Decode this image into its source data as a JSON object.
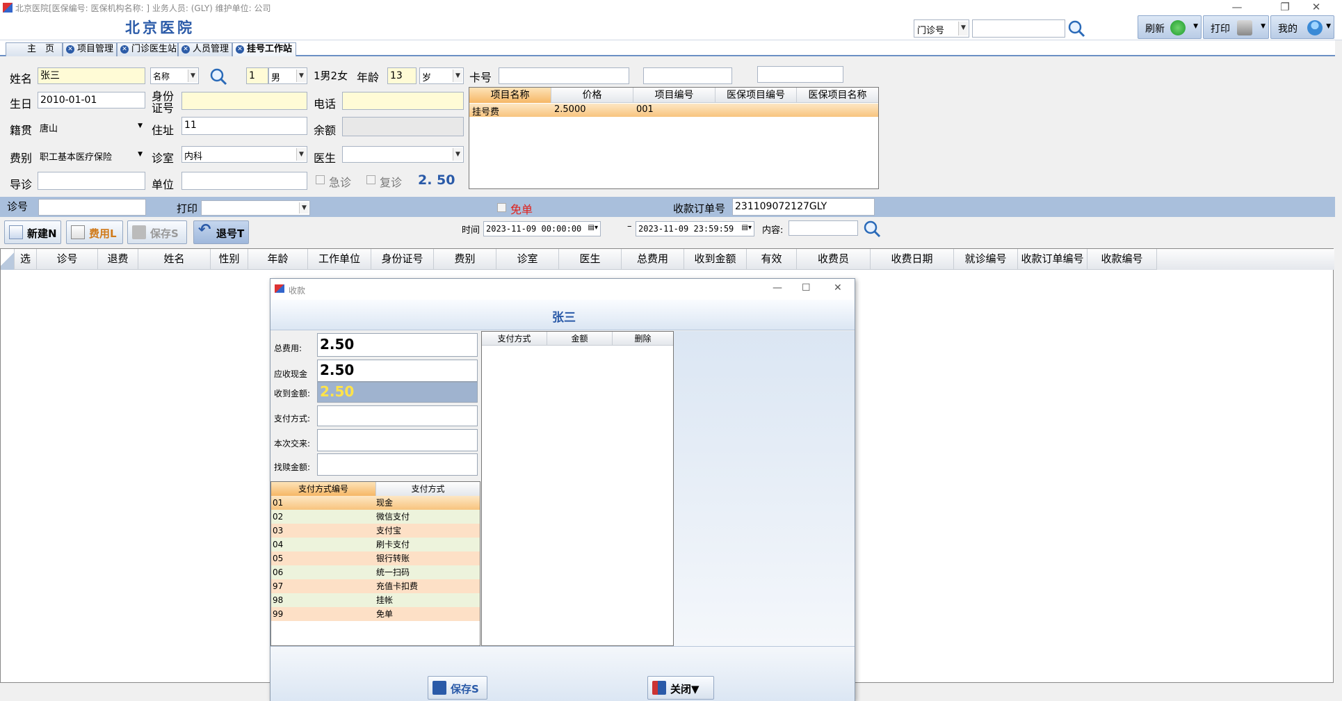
{
  "window": {
    "title": "北京医院[医保编号: 医保机构名称: ] 业务人员: (GLY) 维护单位: 公司",
    "controls": [
      "—",
      "❐",
      "✕"
    ]
  },
  "header": {
    "hospital_name": "北京医院",
    "search_type": "门诊号",
    "search_value": "",
    "refresh_label": "刷新",
    "print_label": "打印",
    "my_label": "我的"
  },
  "tabs": [
    {
      "label": "主　页",
      "active": false
    },
    {
      "label": "项目管理",
      "active": false
    },
    {
      "label": "门诊医生站",
      "active": false
    },
    {
      "label": "人员管理",
      "active": false
    },
    {
      "label": "挂号工作站",
      "active": true
    }
  ],
  "form": {
    "name_label": "姓名",
    "name_value": "张三",
    "name_mode": "名称",
    "gender_code": "1",
    "gender_value": "男",
    "gender_hint": "1男2女",
    "age_label": "年龄",
    "age_value": "13",
    "age_unit": "岁",
    "card_label": "卡号",
    "card_value": "",
    "card_extra1": "",
    "card_extra2": "",
    "birthday_label": "生日",
    "birthday_value": "2010-01-01",
    "idcard_label": "身份证号",
    "idcard_value": "",
    "phone_label": "电话",
    "phone_value": "",
    "native_label": "籍贯",
    "native_value": "唐山",
    "address_label": "住址",
    "address_value": "11",
    "balance_label": "余额",
    "balance_value": "",
    "feetype_label": "费别",
    "feetype_value": "职工基本医疗保险",
    "room_label": "诊室",
    "room_value": "内科",
    "doctor_label": "医生",
    "doctor_value": "",
    "guide_label": "导诊",
    "guide_value": "",
    "unit_label": "单位",
    "unit_value": "",
    "emergency_label": "急诊",
    "revisit_label": "复诊",
    "fee_total": "2. 50"
  },
  "items_table": {
    "headers": [
      "项目名称",
      "价格",
      "项目编号",
      "医保项目编号",
      "医保项目名称"
    ],
    "rows": [
      [
        "挂号费",
        "2.5000",
        "001",
        "",
        ""
      ]
    ]
  },
  "bar": {
    "visit_no_label": "诊号",
    "visit_no_value": "",
    "print_label": "打印",
    "print_value": "",
    "free_label": "免单",
    "order_no_label": "收款订单号",
    "order_no_value": "231109072127GLY"
  },
  "toolbar": {
    "new_label": "新建N",
    "fee_label": "费用L",
    "save_label": "保存S",
    "refund_label": "退号T",
    "time_label": "时间",
    "time_from": "2023-11-09 00:00:00",
    "time_sep": "–",
    "time_to": "2023-11-09 23:59:59",
    "content_label": "内容:",
    "content_value": ""
  },
  "main_grid": {
    "headers": [
      "选",
      "诊号",
      "退费",
      "姓名",
      "性别",
      "年龄",
      "工作单位",
      "身份证号",
      "费别",
      "诊室",
      "医生",
      "总费用",
      "收到金额",
      "有效",
      "收费员",
      "收费日期",
      "就诊编号",
      "收款订单编号",
      "收款编号"
    ]
  },
  "dialog": {
    "title": "收款",
    "patient_name": "张三",
    "total_label": "总费用:",
    "total_value": "2.50",
    "due_label": "应收现金",
    "due_value": "2.50",
    "received_label": "收到金额:",
    "received_value": "2.50",
    "paymethod_label": "支付方式:",
    "paymethod_value": "",
    "change_label": "本次交来:",
    "change_value": "",
    "discount_label": "找赎金额:",
    "discount_value": "",
    "paytypes_headers": [
      "支付方式编号",
      "支付方式"
    ],
    "paytypes": [
      [
        "01",
        "现金"
      ],
      [
        "02",
        "微信支付"
      ],
      [
        "03",
        "支付宝"
      ],
      [
        "04",
        "刷卡支付"
      ],
      [
        "05",
        "银行转账"
      ],
      [
        "06",
        "统一扫码"
      ],
      [
        "97",
        "充值卡扣费"
      ],
      [
        "98",
        "挂帐"
      ],
      [
        "99",
        "免单"
      ]
    ],
    "payments_headers": [
      "支付方式",
      "金额",
      "删除"
    ],
    "save_label": "保存S",
    "close_label": "关闭▼"
  },
  "colors": {
    "accent": "#2a5aa8",
    "bar_blue": "#a9bfdc",
    "highlight": "#f9c98a",
    "yellow_input": "#fffbd6"
  }
}
